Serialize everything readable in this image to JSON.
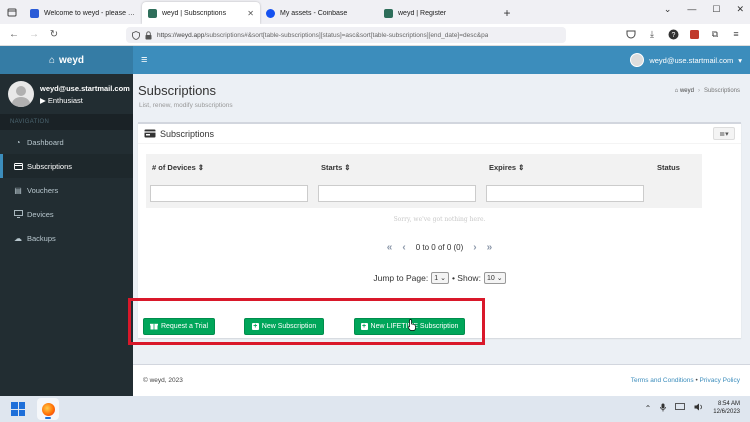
{
  "browser": {
    "tabs": [
      {
        "label": "Welcome to weyd - please veri",
        "favicon_color": "#2a5bd7",
        "active": false
      },
      {
        "label": "weyd | Subscriptions",
        "favicon_color": "#2e6e5a",
        "active": true
      },
      {
        "label": "My assets - Coinbase",
        "favicon_color": "#1652f0",
        "active": false
      },
      {
        "label": "weyd | Register",
        "favicon_color": "#2e6e5a",
        "active": false
      }
    ],
    "url_host": "https://weyd.app",
    "url_path": "/subscriptions#&sort[table-subscriptions][status]=asc&sort[table-subscriptions][end_date]=desc&pa"
  },
  "app": {
    "brand": "weyd",
    "top_user_email": "weyd@use.startmail.com"
  },
  "sidebar": {
    "user_email": "weyd@use.startmail.com",
    "user_role": "Enthusiast",
    "nav_header": "NAVIGATION",
    "items": [
      {
        "label": "Dashboard",
        "icon": "dashboard-icon"
      },
      {
        "label": "Subscriptions",
        "icon": "credit-card-icon"
      },
      {
        "label": "Vouchers",
        "icon": "voucher-icon"
      },
      {
        "label": "Devices",
        "icon": "monitor-icon"
      },
      {
        "label": "Backups",
        "icon": "cloud-icon"
      }
    ]
  },
  "page": {
    "title": "Subscriptions",
    "subtitle": "List, renew, modify subscriptions",
    "breadcrumb_home": "weyd",
    "breadcrumb_current": "Subscriptions"
  },
  "box": {
    "title": "Subscriptions",
    "columns": [
      "# of Devices",
      "Starts",
      "Expires",
      "Status"
    ],
    "empty_message": "Sorry, we've got nothing here.",
    "pager_text": "0 to 0 of 0 (0)",
    "jump_label": "Jump to Page:",
    "jump_value": "1",
    "show_label": "• Show:",
    "show_value": "10",
    "buttons": {
      "trial": "Request a Trial",
      "new": "New Subscription",
      "lifetime": "New LIFETIME Subscription"
    }
  },
  "footer": {
    "copyright": "© weyd, 2023",
    "terms": "Terms and Conditions",
    "sep": " • ",
    "privacy": "Privacy Policy"
  },
  "taskbar": {
    "time": "8:54 AM",
    "date": "12/6/2023"
  },
  "colors": {
    "brand_dark": "#357ca5",
    "brand": "#3c8dbc",
    "success": "#00a65a",
    "highlight": "#d9182a",
    "sidebar": "#222d32"
  }
}
